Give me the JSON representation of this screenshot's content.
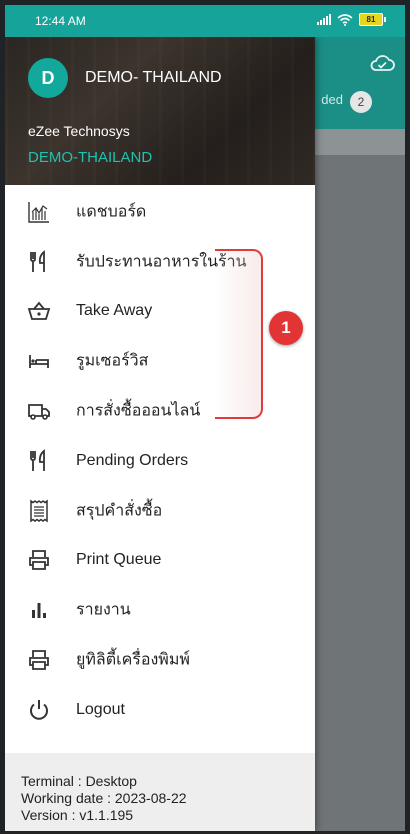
{
  "status_bar": {
    "time": "12:44 AM",
    "battery": "81"
  },
  "background": {
    "loaded_label": "ded",
    "loaded_count": "2"
  },
  "drawer": {
    "avatar_letter": "D",
    "header_name": "DEMO- THAILAND",
    "company": "eZee Technosys",
    "outlet": "DEMO-THAILAND",
    "menu": [
      {
        "label": "แดชบอร์ด",
        "icon": "dashboard-chart-icon"
      },
      {
        "label": "รับประทานอาหารในร้าน",
        "icon": "fork-knife-icon"
      },
      {
        "label": "Take Away",
        "icon": "basket-icon"
      },
      {
        "label": "รูมเซอร์วิส",
        "icon": "bed-icon"
      },
      {
        "label": "การสั่งซื้อออนไลน์",
        "icon": "truck-icon"
      },
      {
        "label": "Pending Orders",
        "icon": "fork-knife-icon"
      },
      {
        "label": "สรุปคำสั่งซื้อ",
        "icon": "receipt-icon"
      },
      {
        "label": "Print Queue",
        "icon": "printer-icon"
      },
      {
        "label": "รายงาน",
        "icon": "bar-chart-icon"
      },
      {
        "label": "ยูทิลิตี้เครื่องพิมพ์",
        "icon": "printer-icon"
      },
      {
        "label": "Logout",
        "icon": "power-icon"
      }
    ],
    "footer": {
      "terminal": "Terminal : Desktop",
      "working_date": "Working date : 2023-08-22",
      "version": "Version : v1.1.195"
    }
  },
  "annotation": {
    "marker_label": "1",
    "color": "#e23434"
  }
}
